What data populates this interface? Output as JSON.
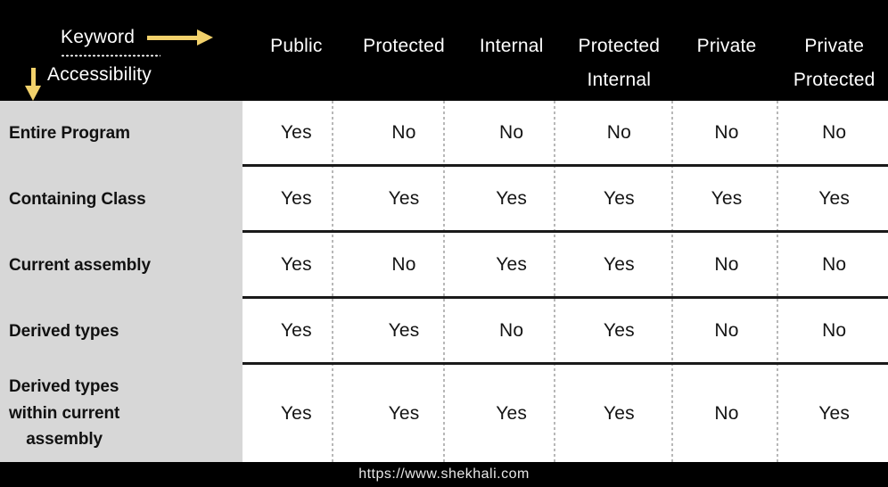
{
  "header": {
    "corner": {
      "keyword_label": "Keyword",
      "accessibility_label": "Accessibility",
      "arrow_right_icon": "arrow-right-icon",
      "arrow_down_icon": "arrow-down-icon",
      "arrow_color": "#f2d16b"
    },
    "columns": [
      {
        "line1": "Public",
        "line2": ""
      },
      {
        "line1": "Protected",
        "line2": ""
      },
      {
        "line1": "Internal",
        "line2": ""
      },
      {
        "line1": "Protected",
        "line2": "Internal"
      },
      {
        "line1": "Private",
        "line2": ""
      },
      {
        "line1": "Private",
        "line2": "Protected"
      }
    ]
  },
  "table": {
    "rows": [
      {
        "label_lines": [
          "Entire Program"
        ],
        "values": [
          "Yes",
          "No",
          "No",
          "No",
          "No",
          "No"
        ]
      },
      {
        "label_lines": [
          "Containing Class"
        ],
        "values": [
          "Yes",
          "Yes",
          "Yes",
          "Yes",
          "Yes",
          "Yes"
        ]
      },
      {
        "label_lines": [
          "Current assembly"
        ],
        "values": [
          "Yes",
          "No",
          "Yes",
          "Yes",
          "No",
          "No"
        ]
      },
      {
        "label_lines": [
          "Derived types"
        ],
        "values": [
          "Yes",
          "Yes",
          "No",
          "Yes",
          "No",
          "No"
        ]
      },
      {
        "label_lines": [
          "Derived types",
          "within current",
          "assembly"
        ],
        "values": [
          "Yes",
          "Yes",
          "Yes",
          "Yes",
          "No",
          "Yes"
        ]
      }
    ]
  },
  "footer": {
    "url": "https://www.shekhali.com"
  },
  "colors": {
    "header_bg": "#000000",
    "label_col_bg": "#d7d7d7",
    "data_bg": "#ffffff",
    "accent": "#f2d16b",
    "row_rule": "#1a1a1a",
    "col_rule": "#b8b8b8"
  }
}
